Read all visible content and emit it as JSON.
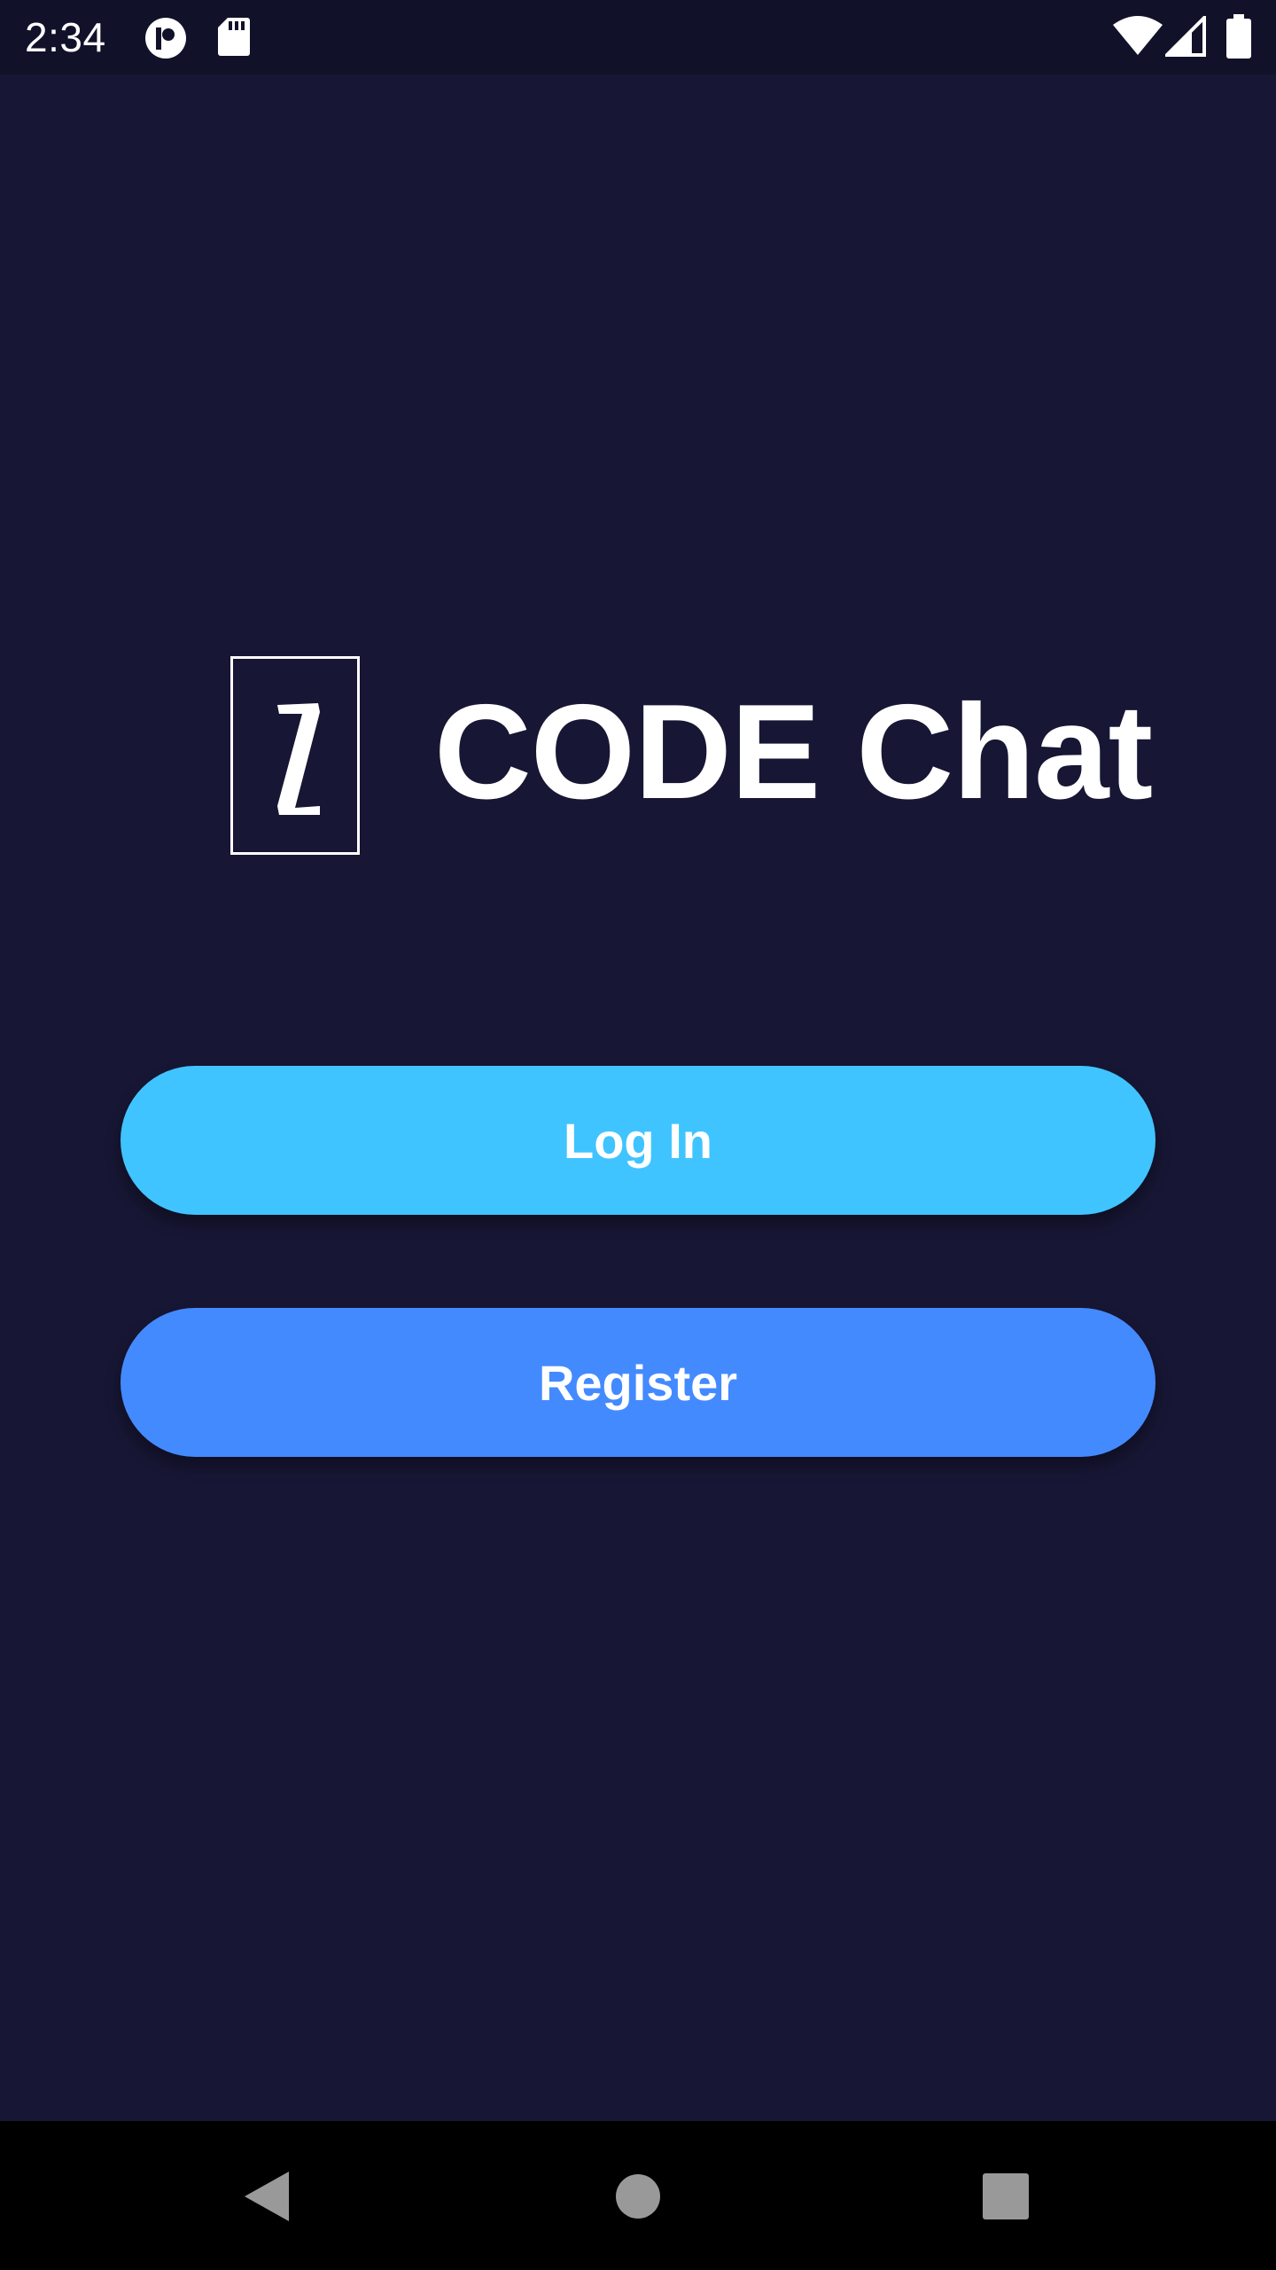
{
  "status_bar": {
    "time": "2:34",
    "icons": [
      "app-notification-icon",
      "sd-card-icon",
      "wifi-icon",
      "cell-signal-icon",
      "battery-icon"
    ]
  },
  "app": {
    "logo_letter": "Z",
    "title": "CODE Chat"
  },
  "buttons": {
    "login_label": "Log In",
    "register_label": "Register"
  },
  "nav_bar": {
    "icons": [
      "back-icon",
      "home-icon",
      "recents-icon"
    ]
  },
  "colors": {
    "background": "#171634",
    "status_bar": "#11112a",
    "login_button": "#40c4ff",
    "register_button": "#448aff",
    "nav_bar": "#000000"
  }
}
